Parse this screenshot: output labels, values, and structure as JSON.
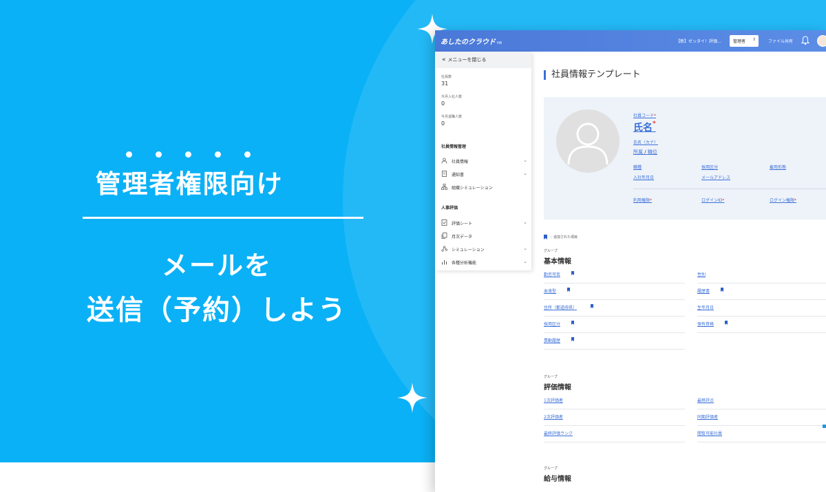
{
  "hero": {
    "title": "管理者権限向け",
    "subtitle_line1": "メールを",
    "subtitle_line2": "送信（予約）しよう",
    "colors": {
      "background": "#0bb1f6",
      "text": "#ffffff"
    }
  },
  "header": {
    "logo": "あしたのクラウド",
    "logo_sub": "HR",
    "notice": "【新】ゼッタイ！評価…",
    "role_select": "管理者",
    "file_share": "ファイル共有",
    "bell_icon": "bell-icon",
    "color": "#4a78d8"
  },
  "sidebar": {
    "close_menu": "メニューを閉じる",
    "stats": [
      {
        "label": "社員数",
        "value": "31"
      },
      {
        "label": "今月入社人数",
        "value": "0"
      },
      {
        "label": "今月退職人数",
        "value": "0"
      }
    ],
    "sections": [
      {
        "title": "社員情報管理",
        "items": [
          {
            "label": "社員情報",
            "icon": "person-icon",
            "expandable": true
          },
          {
            "label": "通知書",
            "icon": "document-icon",
            "expandable": true
          },
          {
            "label": "組織シミュレーション",
            "icon": "org-chart-icon",
            "expandable": false
          }
        ]
      },
      {
        "title": "人事評価",
        "items": [
          {
            "label": "評価シート",
            "icon": "checklist-icon",
            "expandable": true
          },
          {
            "label": "月次データ",
            "icon": "copy-icon",
            "expandable": false
          },
          {
            "label": "シミュレーション",
            "icon": "nodes-icon",
            "expandable": true
          },
          {
            "label": "各種分析機能",
            "icon": "bar-chart-icon",
            "expandable": true
          }
        ]
      }
    ]
  },
  "main": {
    "page_title": "社員情報テンプレート",
    "profile": {
      "employee_code": "社員コード",
      "name": "氏名",
      "name_kana": "氏名（カナ）",
      "affiliation": "所属",
      "separator": "/",
      "position": "職位",
      "row1": [
        "職種",
        "採用区分",
        "雇用形態"
      ],
      "row2": [
        "入社年月日",
        "メールアドレス"
      ],
      "row3": [
        "利用権限",
        "ログインID",
        "ログイン権限"
      ],
      "required_mark": "*"
    },
    "legend": "：追加された項目",
    "groups": [
      {
        "label": "グループ",
        "title": "基本情報",
        "fields": [
          {
            "label": "勤怠可否",
            "added": true
          },
          {
            "label": "性別",
            "added": false
          },
          {
            "label": "血液型",
            "added": true
          },
          {
            "label": "履歴書",
            "added": true
          },
          {
            "label": "住所（都道府県）",
            "added": true
          },
          {
            "label": "生年月日",
            "added": false
          },
          {
            "label": "採用区分",
            "added": true
          },
          {
            "label": "保有資格",
            "added": true
          },
          {
            "label": "異動履歴",
            "added": true
          }
        ]
      },
      {
        "label": "グループ",
        "title": "評価情報",
        "fields": [
          {
            "label": "1次評価者",
            "added": false
          },
          {
            "label": "最終評点",
            "added": false
          },
          {
            "label": "2次評価者",
            "added": false
          },
          {
            "label": "同期評価者",
            "added": false
          },
          {
            "label": "最終評価ランク",
            "added": false
          },
          {
            "label": "閲覧可能社員",
            "added": false
          }
        ]
      },
      {
        "label": "グループ",
        "title": "給与情報"
      }
    ]
  }
}
